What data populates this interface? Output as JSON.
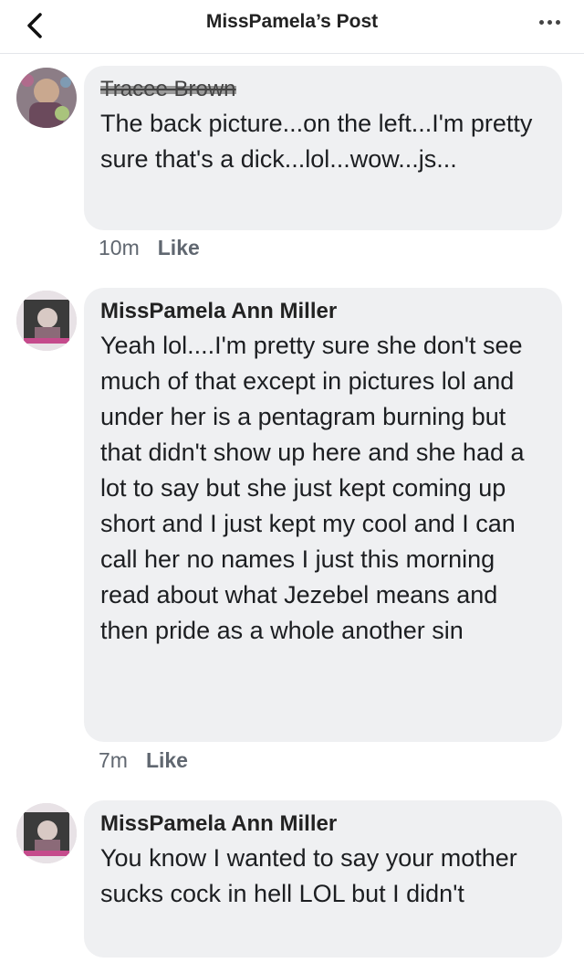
{
  "header": {
    "title": "MissPamela’s Post",
    "back_icon": "chevron-left-icon",
    "more_icon": "more-dots-icon"
  },
  "comments": [
    {
      "author": "Tracee Brown",
      "text": "The back picture...on the left...I'm pretty sure that's a dick...lol...wow...js...",
      "time": "10m",
      "like_label": "Like"
    },
    {
      "author": "MissPamela Ann Miller",
      "text": "Yeah lol....I'm pretty sure she don't see much of that except in pictures lol and under her is a pentagram burning but that didn't show up here and she had a lot to say but she just kept coming up short and I just kept my cool and I can call her no names I just this morning read about what Jezebel means and then pride as a whole another sin",
      "time": "7m",
      "like_label": "Like"
    },
    {
      "author": "MissPamela Ann Miller",
      "text": "You know I wanted to say your mother sucks cock in hell LOL but I didn't"
    }
  ]
}
